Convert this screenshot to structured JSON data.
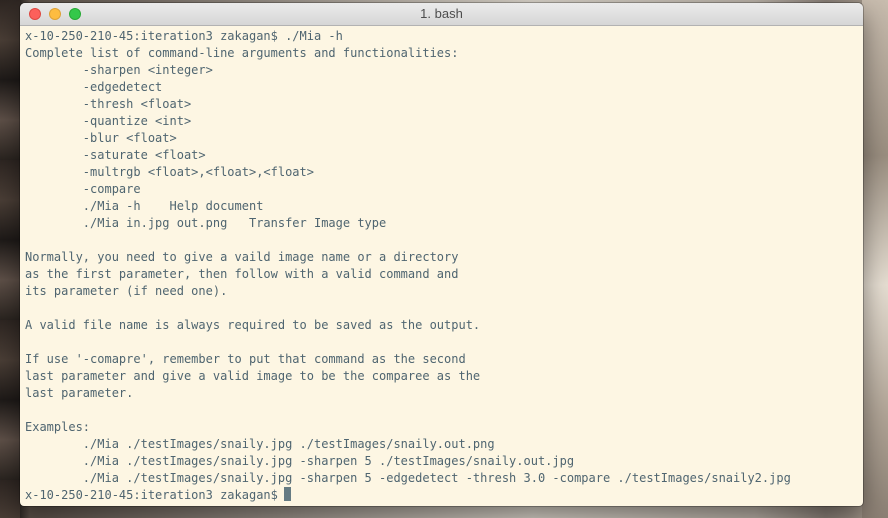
{
  "window": {
    "title": "1. bash"
  },
  "terminal": {
    "lines": [
      "x-10-250-210-45:iteration3 zakagan$ ./Mia -h",
      "Complete list of command-line arguments and functionalities:",
      "        -sharpen <integer>",
      "        -edgedetect",
      "        -thresh <float>",
      "        -quantize <int>",
      "        -blur <float>",
      "        -saturate <float>",
      "        -multrgb <float>,<float>,<float>",
      "        -compare",
      "        ./Mia -h    Help document",
      "        ./Mia in.jpg out.png   Transfer Image type",
      "",
      "Normally, you need to give a vaild image name or a directory",
      "as the first parameter, then follow with a valid command and",
      "its parameter (if need one).",
      "",
      "A valid file name is always required to be saved as the output.",
      "",
      "If use '-comapre', remember to put that command as the second",
      "last parameter and give a valid image to be the comparee as the",
      "last parameter.",
      "",
      "Examples:",
      "        ./Mia ./testImages/snaily.jpg ./testImages/snaily.out.png",
      "        ./Mia ./testImages/snaily.jpg -sharpen 5 ./testImages/snaily.out.jpg",
      "        ./Mia ./testImages/snaily.jpg -sharpen 5 -edgedetect -thresh 3.0 -compare ./testImages/snaily2.jpg"
    ],
    "prompt": "x-10-250-210-45:iteration3 zakagan$"
  },
  "colors": {
    "terminal_background": "#fdf6e3",
    "terminal_text": "#4f6570",
    "close_button": "#fc605b",
    "minimize_button": "#fdbc40",
    "maximize_button": "#34c84a"
  }
}
